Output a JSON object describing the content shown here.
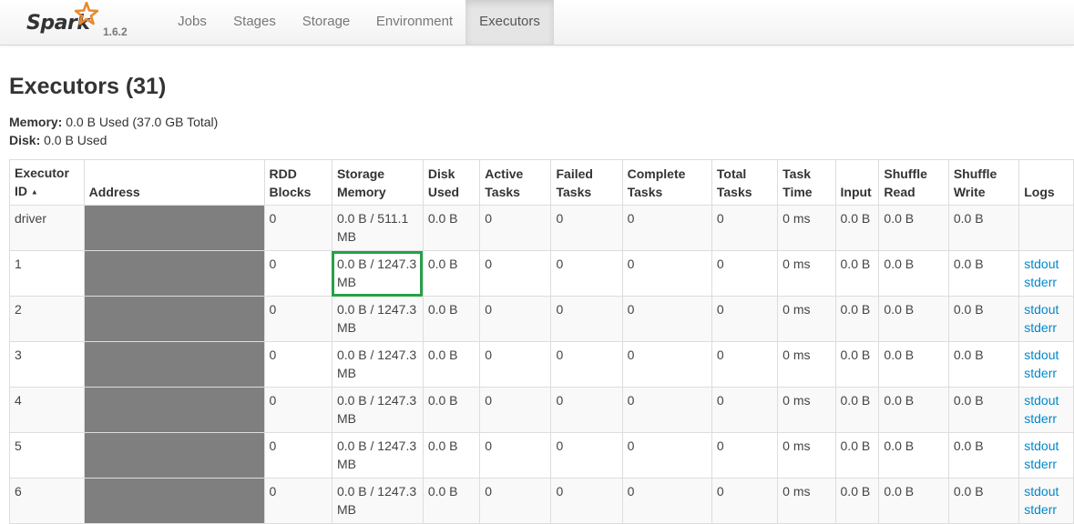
{
  "app": {
    "name": "Spark",
    "version": "1.6.2"
  },
  "nav": {
    "tabs": [
      {
        "label": "Jobs"
      },
      {
        "label": "Stages"
      },
      {
        "label": "Storage"
      },
      {
        "label": "Environment"
      },
      {
        "label": "Executors",
        "active": true
      }
    ]
  },
  "page": {
    "title": "Executors (31)",
    "memory_label": "Memory:",
    "memory_value": " 0.0 B Used (37.0 GB Total)",
    "disk_label": "Disk:",
    "disk_value": " 0.0 B Used"
  },
  "table": {
    "headers": {
      "executor_id_1": "Executor",
      "executor_id_2": "ID",
      "sort_arrow": "▲",
      "address": "Address",
      "rdd_1": "RDD",
      "rdd_2": "Blocks",
      "storage_1": "Storage",
      "storage_2": "Memory",
      "disk_1": "Disk",
      "disk_2": "Used",
      "active_1": "Active",
      "active_2": "Tasks",
      "failed_1": "Failed",
      "failed_2": "Tasks",
      "complete_1": "Complete",
      "complete_2": "Tasks",
      "total_1": "Total",
      "total_2": "Tasks",
      "tasktime_1": "Task",
      "tasktime_2": "Time",
      "input": "Input",
      "shuffle_read_1": "Shuffle",
      "shuffle_read_2": "Read",
      "shuffle_write_1": "Shuffle",
      "shuffle_write_2": "Write",
      "logs": "Logs"
    },
    "rows": [
      {
        "id": "driver",
        "rdd": "0",
        "storage": "0.0 B / 511.1 MB",
        "disk": "0.0 B",
        "active": "0",
        "failed": "0",
        "complete": "0",
        "total": "0",
        "time": "0 ms",
        "input": "0.0 B",
        "sread": "0.0 B",
        "swrite": "0.0 B",
        "stdout": "",
        "stderr": ""
      },
      {
        "id": "1",
        "rdd": "0",
        "storage": "0.0 B / 1247.3 MB",
        "disk": "0.0 B",
        "active": "0",
        "failed": "0",
        "complete": "0",
        "total": "0",
        "time": "0 ms",
        "input": "0.0 B",
        "sread": "0.0 B",
        "swrite": "0.0 B",
        "stdout": "stdout",
        "stderr": "stderr"
      },
      {
        "id": "2",
        "rdd": "0",
        "storage": "0.0 B / 1247.3 MB",
        "disk": "0.0 B",
        "active": "0",
        "failed": "0",
        "complete": "0",
        "total": "0",
        "time": "0 ms",
        "input": "0.0 B",
        "sread": "0.0 B",
        "swrite": "0.0 B",
        "stdout": "stdout",
        "stderr": "stderr"
      },
      {
        "id": "3",
        "rdd": "0",
        "storage": "0.0 B / 1247.3 MB",
        "disk": "0.0 B",
        "active": "0",
        "failed": "0",
        "complete": "0",
        "total": "0",
        "time": "0 ms",
        "input": "0.0 B",
        "sread": "0.0 B",
        "swrite": "0.0 B",
        "stdout": "stdout",
        "stderr": "stderr"
      },
      {
        "id": "4",
        "rdd": "0",
        "storage": "0.0 B / 1247.3 MB",
        "disk": "0.0 B",
        "active": "0",
        "failed": "0",
        "complete": "0",
        "total": "0",
        "time": "0 ms",
        "input": "0.0 B",
        "sread": "0.0 B",
        "swrite": "0.0 B",
        "stdout": "stdout",
        "stderr": "stderr"
      },
      {
        "id": "5",
        "rdd": "0",
        "storage": "0.0 B / 1247.3 MB",
        "disk": "0.0 B",
        "active": "0",
        "failed": "0",
        "complete": "0",
        "total": "0",
        "time": "0 ms",
        "input": "0.0 B",
        "sread": "0.0 B",
        "swrite": "0.0 B",
        "stdout": "stdout",
        "stderr": "stderr"
      },
      {
        "id": "6",
        "rdd": "0",
        "storage": "0.0 B / 1247.3 MB",
        "disk": "0.0 B",
        "active": "0",
        "failed": "0",
        "complete": "0",
        "total": "0",
        "time": "0 ms",
        "input": "0.0 B",
        "sread": "0.0 B",
        "swrite": "0.0 B",
        "stdout": "stdout",
        "stderr": "stderr"
      }
    ]
  },
  "colors": {
    "link": "#0088cc",
    "highlight": "#27a048",
    "redaction": "#7f7f7f",
    "brand_star": "#e8892d"
  }
}
